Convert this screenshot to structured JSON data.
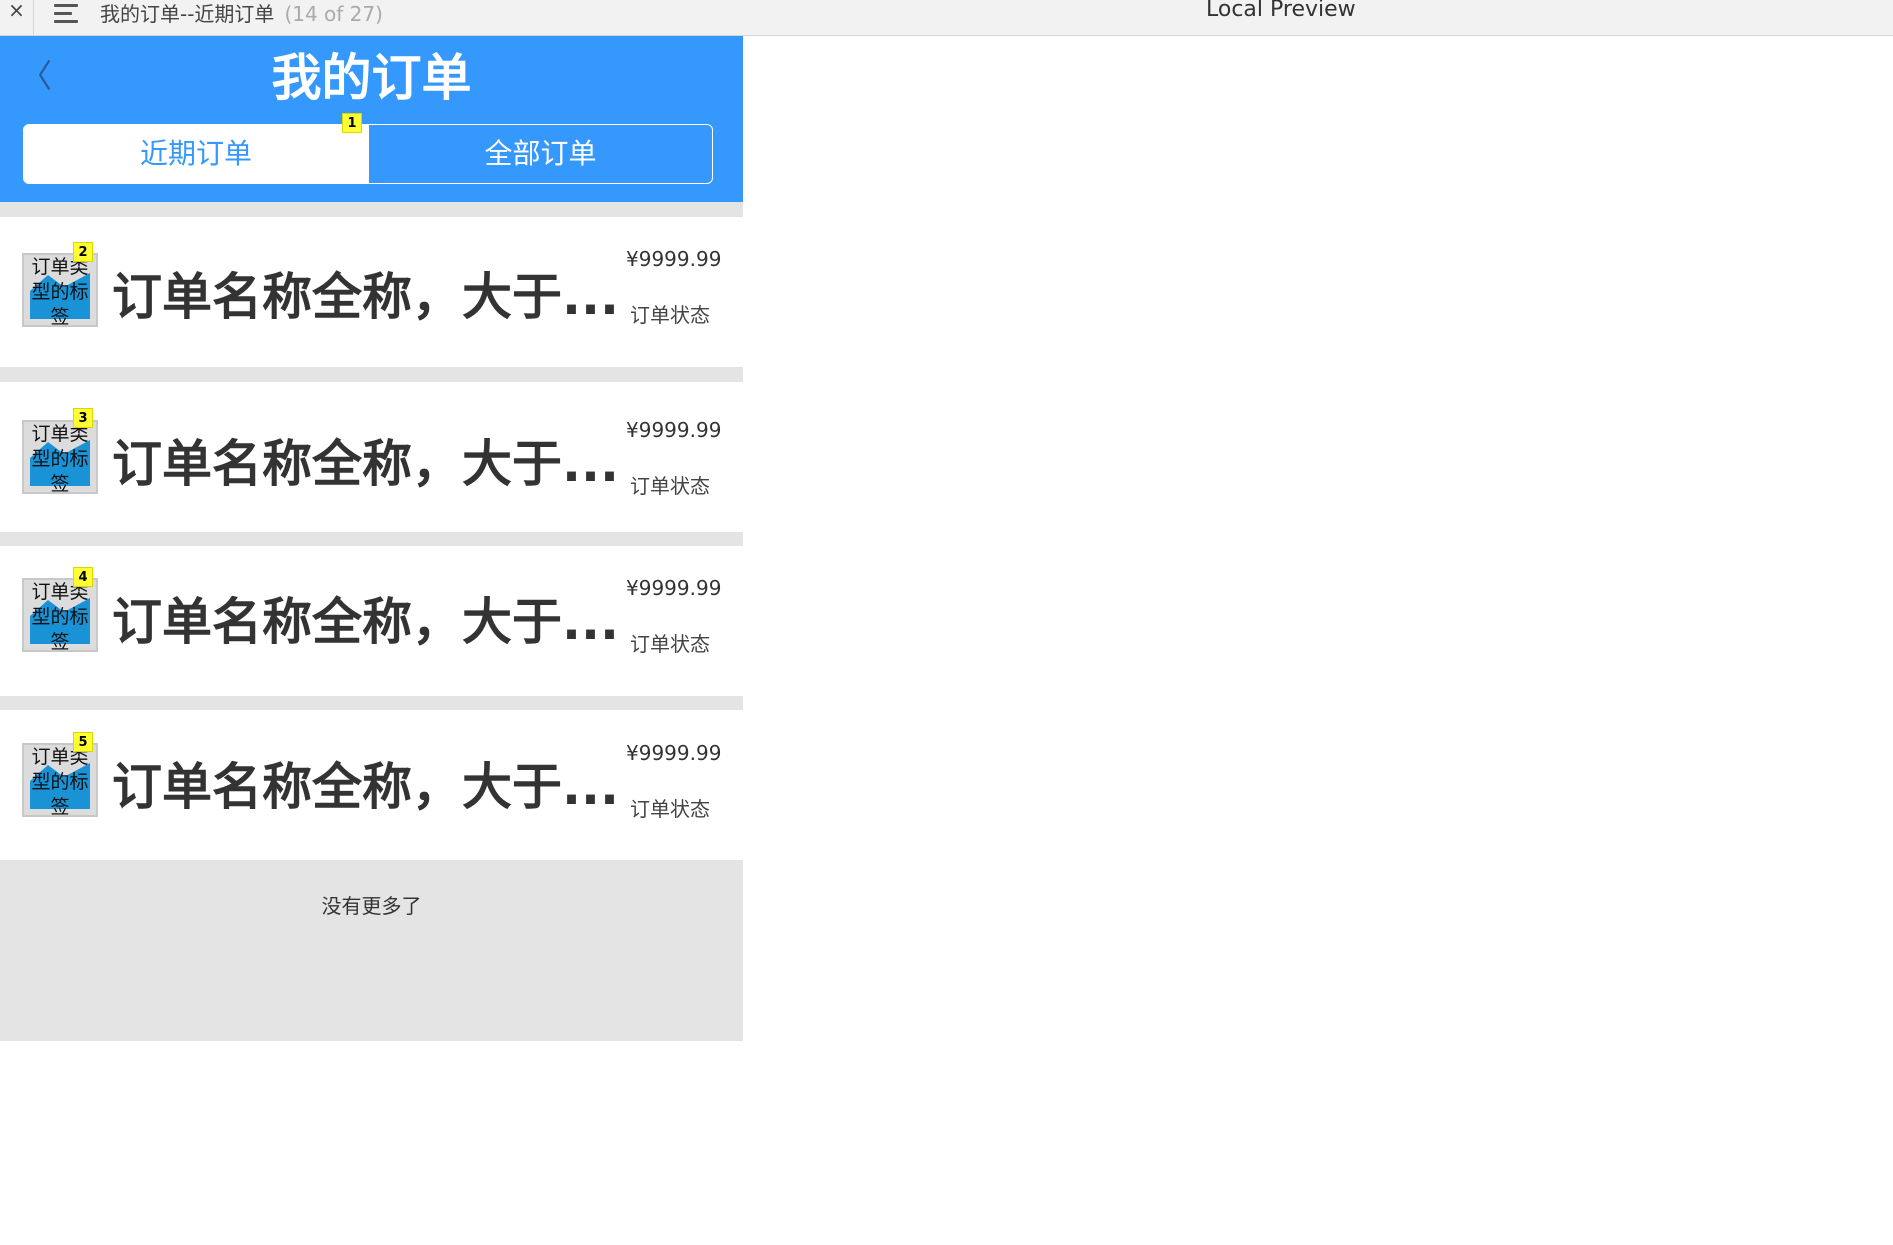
{
  "browser": {
    "close_glyph": "×",
    "page_title": "我的订单--近期订单",
    "page_count": "(14 of 27)",
    "preview_title": "Local Preview"
  },
  "header": {
    "back_glyph": "〈",
    "title": "我的订单",
    "tabs": [
      {
        "label": "近期订单",
        "active": true
      },
      {
        "label": "全部订单",
        "active": false
      }
    ],
    "badge": "1"
  },
  "orders": [
    {
      "badge": "2",
      "thumb_text": "订单类型的标签",
      "name": "订单名称全称，大于...",
      "price": "¥9999.99",
      "status": "订单状态"
    },
    {
      "badge": "3",
      "thumb_text": "订单类型的标签",
      "name": "订单名称全称，大于...",
      "price": "¥9999.99",
      "status": "订单状态"
    },
    {
      "badge": "4",
      "thumb_text": "订单类型的标签",
      "name": "订单名称全称，大于...",
      "price": "¥9999.99",
      "status": "订单状态"
    },
    {
      "badge": "5",
      "thumb_text": "订单类型的标签",
      "name": "订单名称全称，大于...",
      "price": "¥9999.99",
      "status": "订单状态"
    }
  ],
  "footer": {
    "no_more": "没有更多了"
  },
  "colors": {
    "accent": "#3598fc",
    "background_gray": "#e4e4e4",
    "badge_yellow": "#ffff33"
  }
}
